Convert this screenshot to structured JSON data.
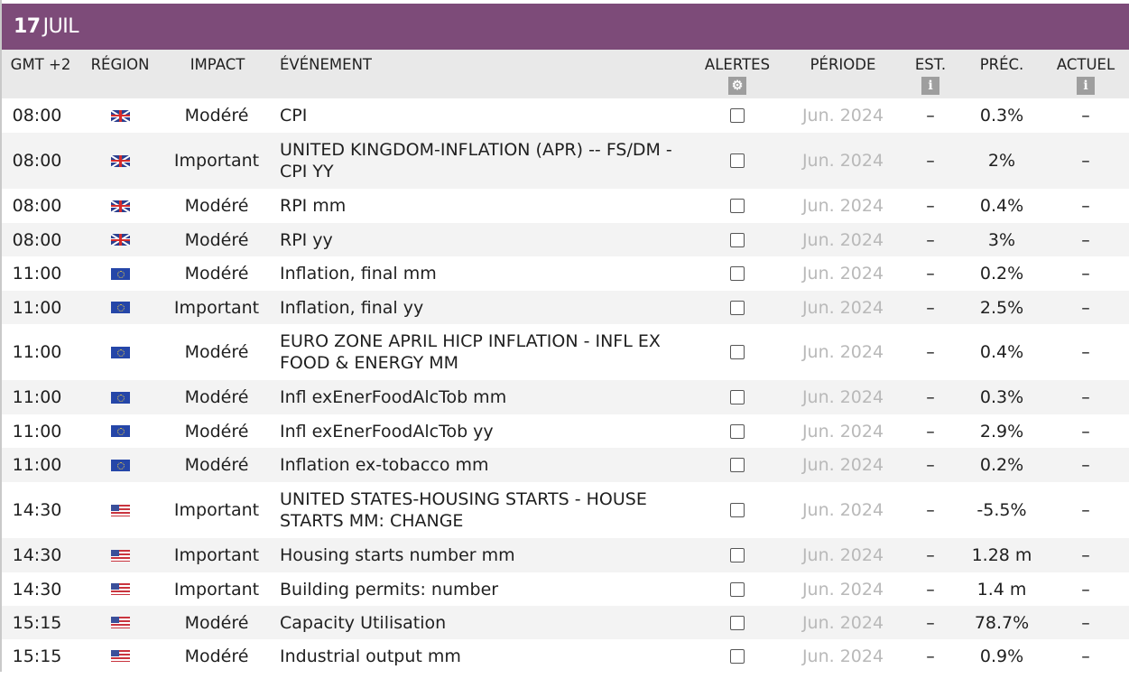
{
  "date": {
    "day": "17",
    "month": "JUIL"
  },
  "headers": {
    "time": "GMT +2",
    "region": "RÉGION",
    "impact": "IMPACT",
    "event": "ÉVÉNEMENT",
    "alerts": "ALERTES",
    "period": "PÉRIODE",
    "est": "EST.",
    "prev": "PRÉC.",
    "actual": "ACTUEL"
  },
  "header_icons": {
    "alerts": "gear-icon",
    "est": "info-icon",
    "actual": "info-icon"
  },
  "colors": {
    "date_bar": "#7d4b79",
    "header_bg": "#e9e9e9",
    "alt_row": "#f3f3f3",
    "period_text": "#b9b9b9"
  },
  "rows": [
    {
      "time": "08:00",
      "flag": "uk-flag-icon",
      "impact": "Modéré",
      "event": "CPI",
      "period": "Jun. 2024",
      "est": "–",
      "prev": "0.3%",
      "actual": "–"
    },
    {
      "time": "08:00",
      "flag": "uk-flag-icon",
      "impact": "Important",
      "event": "UNITED KINGDOM-INFLATION (APR) -- FS/DM - CPI YY",
      "period": "Jun. 2024",
      "est": "–",
      "prev": "2%",
      "actual": "–"
    },
    {
      "time": "08:00",
      "flag": "uk-flag-icon",
      "impact": "Modéré",
      "event": "RPI mm",
      "period": "Jun. 2024",
      "est": "–",
      "prev": "0.4%",
      "actual": "–"
    },
    {
      "time": "08:00",
      "flag": "uk-flag-icon",
      "impact": "Modéré",
      "event": "RPI yy",
      "period": "Jun. 2024",
      "est": "–",
      "prev": "3%",
      "actual": "–"
    },
    {
      "time": "11:00",
      "flag": "eu-flag-icon",
      "impact": "Modéré",
      "event": "Inflation, final mm",
      "period": "Jun. 2024",
      "est": "–",
      "prev": "0.2%",
      "actual": "–"
    },
    {
      "time": "11:00",
      "flag": "eu-flag-icon",
      "impact": "Important",
      "event": "Inflation, final yy",
      "period": "Jun. 2024",
      "est": "–",
      "prev": "2.5%",
      "actual": "–"
    },
    {
      "time": "11:00",
      "flag": "eu-flag-icon",
      "impact": "Modéré",
      "event": "EURO ZONE APRIL HICP INFLATION - INFL EX FOOD & ENERGY MM",
      "period": "Jun. 2024",
      "est": "–",
      "prev": "0.4%",
      "actual": "–"
    },
    {
      "time": "11:00",
      "flag": "eu-flag-icon",
      "impact": "Modéré",
      "event": "Infl exEnerFoodAlcTob mm",
      "period": "Jun. 2024",
      "est": "–",
      "prev": "0.3%",
      "actual": "–"
    },
    {
      "time": "11:00",
      "flag": "eu-flag-icon",
      "impact": "Modéré",
      "event": "Infl exEnerFoodAlcTob yy",
      "period": "Jun. 2024",
      "est": "–",
      "prev": "2.9%",
      "actual": "–"
    },
    {
      "time": "11:00",
      "flag": "eu-flag-icon",
      "impact": "Modéré",
      "event": "Inflation ex-tobacco mm",
      "period": "Jun. 2024",
      "est": "–",
      "prev": "0.2%",
      "actual": "–"
    },
    {
      "time": "14:30",
      "flag": "us-flag-icon",
      "impact": "Important",
      "event": "UNITED STATES-HOUSING STARTS - HOUSE STARTS MM: CHANGE",
      "period": "Jun. 2024",
      "est": "–",
      "prev": "-5.5%",
      "actual": "–"
    },
    {
      "time": "14:30",
      "flag": "us-flag-icon",
      "impact": "Important",
      "event": "Housing starts number mm",
      "period": "Jun. 2024",
      "est": "–",
      "prev": "1.28 m",
      "actual": "–"
    },
    {
      "time": "14:30",
      "flag": "us-flag-icon",
      "impact": "Important",
      "event": "Building permits: number",
      "period": "Jun. 2024",
      "est": "–",
      "prev": "1.4 m",
      "actual": "–"
    },
    {
      "time": "15:15",
      "flag": "us-flag-icon",
      "impact": "Modéré",
      "event": "Capacity Utilisation",
      "period": "Jun. 2024",
      "est": "–",
      "prev": "78.7%",
      "actual": "–"
    },
    {
      "time": "15:15",
      "flag": "us-flag-icon",
      "impact": "Modéré",
      "event": "Industrial output mm",
      "period": "Jun. 2024",
      "est": "–",
      "prev": "0.9%",
      "actual": "–"
    }
  ]
}
